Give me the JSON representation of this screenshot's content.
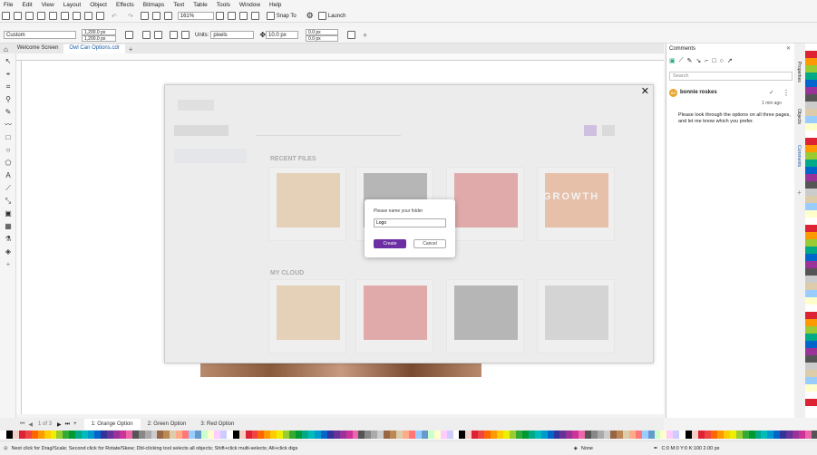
{
  "menu": [
    "File",
    "Edit",
    "View",
    "Layout",
    "Object",
    "Effects",
    "Bitmaps",
    "Text",
    "Table",
    "Tools",
    "Window",
    "Help"
  ],
  "toolbar": {
    "zoom": "161%",
    "snap_label": "Snap To",
    "launch_label": "Launch"
  },
  "propbar": {
    "preset": "Custom",
    "width": "1,200.0 px",
    "height": "1,200.0 px",
    "units_label": "Units:",
    "units": "pixels",
    "nudge": "10.0 px",
    "dup_x": "0.0 px",
    "dup_y": "0.0 px"
  },
  "doc_tabs": [
    {
      "label": "Welcome Screen"
    },
    {
      "label": "Owl Can Options.cdr"
    }
  ],
  "dialog": {
    "prompt": "Please name your folder",
    "value": "Logo",
    "create": "Create",
    "cancel": "Cancel"
  },
  "overlay_bg": {
    "recent": "RECENT FILES",
    "cloud": "MY CLOUD",
    "growth": "GROWTH"
  },
  "comments": {
    "title": "Comments",
    "search_placeholder": "Search",
    "author": "bonnie roskes",
    "author_initials": "BR",
    "time": "1 min ago",
    "text": "Please look through the options on all three pages, and let me know which you prefer."
  },
  "side_tabs": [
    "Properties",
    "Objects",
    "Comments"
  ],
  "pages": {
    "counter": "1 of 3",
    "tabs": [
      "1: Orange Option",
      "2: Green Option",
      "3: Red Option"
    ]
  },
  "status": {
    "hint": "Next click for Drag/Scale; Second click for Rotate/Skew; Dbl-clicking tool selects all objects; Shift+click multi-selects; Alt+click digs",
    "fill": "None",
    "outline": "C:0 M:0 Y:0 K:100  2.00 px"
  },
  "colors": {
    "accent": "#6b2fa3",
    "link": "#1a5aa8"
  }
}
